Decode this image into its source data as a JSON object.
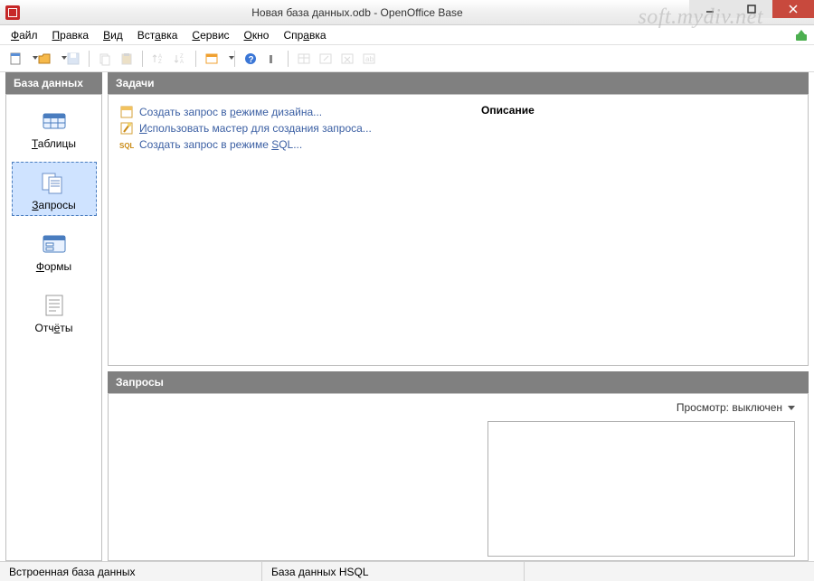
{
  "window": {
    "title": "Новая база данных.odb - OpenOffice Base",
    "watermark": "soft.mydiv.net"
  },
  "menu": {
    "file": {
      "pre": "",
      "ul": "Ф",
      "post": "айл"
    },
    "edit": {
      "pre": "",
      "ul": "П",
      "post": "равка"
    },
    "view": {
      "pre": "",
      "ul": "В",
      "post": "ид"
    },
    "insert": {
      "pre": "Вст",
      "ul": "а",
      "post": "вка"
    },
    "tools": {
      "pre": "",
      "ul": "С",
      "post": "ервис"
    },
    "window": {
      "pre": "",
      "ul": "О",
      "post": "кно"
    },
    "help": {
      "pre": "Спр",
      "ul": "а",
      "post": "вка"
    }
  },
  "sidebar": {
    "header": "База данных",
    "items": [
      {
        "ul": "Т",
        "post": "аблицы",
        "key": "tables"
      },
      {
        "ul": "З",
        "post": "апросы",
        "key": "queries",
        "selected": true
      },
      {
        "ul": "Ф",
        "post": "ормы",
        "key": "forms"
      },
      {
        "pre": "Отч",
        "ul": "ё",
        "post": "ты",
        "key": "reports"
      }
    ]
  },
  "tasks": {
    "header": "Задачи",
    "desc_header": "Описание",
    "items": [
      {
        "text_pre": "Создать запрос в ",
        "ul": "р",
        "text_post": "ежиме дизайна..."
      },
      {
        "text_pre": "",
        "ul": "И",
        "text_post": "спользовать мастер для создания запроса..."
      },
      {
        "text_pre": "Создать запрос в режиме ",
        "ul": "S",
        "text_post": "QL..."
      }
    ]
  },
  "list": {
    "header": "Запросы",
    "preview_label": "Просмотр: выключен"
  },
  "status": {
    "a": "Встроенная база данных",
    "b": "База данных HSQL"
  }
}
